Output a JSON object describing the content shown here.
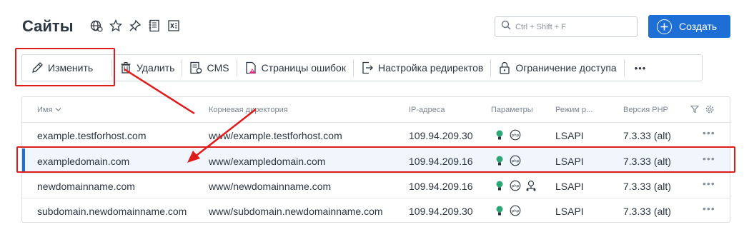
{
  "page": {
    "title": "Сайты"
  },
  "search": {
    "placeholder": "Ctrl + Shift + F"
  },
  "create_button": {
    "label": "Создать"
  },
  "toolbar": {
    "items": [
      {
        "label": "Изменить",
        "icon": "pencil-icon"
      },
      {
        "label": "Удалить",
        "icon": "trash-icon"
      },
      {
        "label": "CMS",
        "icon": "cms-icon"
      },
      {
        "label": "Страницы ошибок",
        "icon": "error-page-icon"
      },
      {
        "label": "Настройка редиректов",
        "icon": "redirect-icon"
      },
      {
        "label": "Ограничение доступа",
        "icon": "lock-icon"
      }
    ],
    "more": "•••"
  },
  "table": {
    "headers": {
      "name": "Имя",
      "root": "Корневая директория",
      "ip": "IP-адреса",
      "params": "Параметры",
      "mode": "Режим р...",
      "php": "Версия PHP"
    },
    "rows": [
      {
        "name": "example.testforhost.com",
        "root": "www/example.testforhost.com",
        "ip": "109.94.209.30",
        "mode": "LSAPI",
        "php": "7.3.33 (alt)",
        "selected": false,
        "more": "•••"
      },
      {
        "name": "exampledomain.com",
        "root": "www/exampledomain.com",
        "ip": "109.94.209.16",
        "mode": "LSAPI",
        "php": "7.3.33 (alt)",
        "selected": true,
        "more": "•••"
      },
      {
        "name": "newdomainname.com",
        "root": "www/newdomainname.com",
        "ip": "109.94.209.16",
        "mode": "LSAPI",
        "php": "7.3.33 (alt)",
        "selected": false,
        "more": "•••"
      },
      {
        "name": "subdomain.newdomainname.com",
        "root": "www/subdomain.newdomainname.com",
        "ip": "109.94.209.30",
        "mode": "LSAPI",
        "php": "7.3.33 (alt)",
        "selected": false,
        "more": "•••"
      }
    ]
  },
  "colors": {
    "accent": "#1d6fd6",
    "highlight": "#e01b1b",
    "ssl_icon": "#2aa876"
  }
}
